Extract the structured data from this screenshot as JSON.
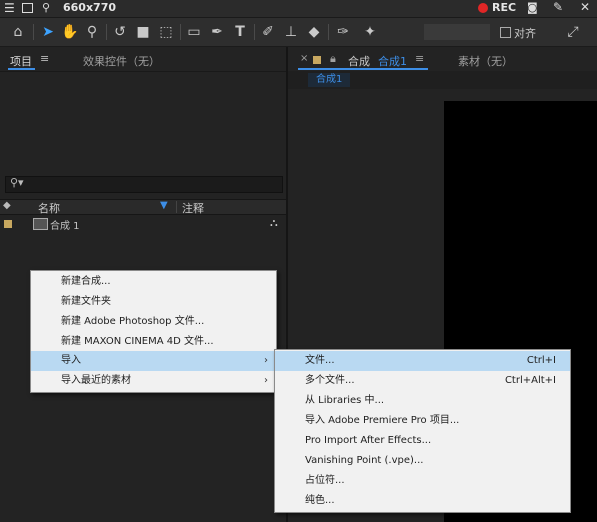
{
  "recorder": {
    "dimensions": "660x770",
    "rec_label": "REC"
  },
  "project_panel": {
    "tab_project": "项目",
    "tab_effects": "效果控件（无）",
    "columns": {
      "name": "名称",
      "comment": "注释"
    },
    "items": [
      {
        "name": "合成 1"
      }
    ]
  },
  "comp_panel": {
    "tab_comp_prefix": "合成",
    "tab_comp_name": "合成1",
    "tab_footage": "素材（无）",
    "breadcrumb": "合成1"
  },
  "toolbar": {
    "snap_label": "对齐"
  },
  "context_menu": {
    "items": [
      {
        "label": "新建合成..."
      },
      {
        "label": "新建文件夹"
      },
      {
        "label": "新建 Adobe Photoshop 文件..."
      },
      {
        "label": "新建 MAXON CINEMA 4D 文件..."
      },
      {
        "label": "导入",
        "has_submenu": true,
        "highlighted": true
      },
      {
        "label": "导入最近的素材",
        "has_submenu": true
      }
    ]
  },
  "import_submenu": {
    "items": [
      {
        "label": "文件...",
        "shortcut": "Ctrl+I",
        "highlighted": true
      },
      {
        "label": "多个文件...",
        "shortcut": "Ctrl+Alt+I"
      },
      {
        "label": "从 Libraries 中..."
      },
      {
        "label": "导入 Adobe Premiere Pro 项目..."
      },
      {
        "label": "Pro Import After Effects..."
      },
      {
        "label": "Vanishing Point (.vpe)..."
      },
      {
        "label": "占位符..."
      },
      {
        "label": "纯色..."
      }
    ]
  },
  "colors": {
    "accent": "#3d8ee6",
    "menu_highlight": "#b9d9f2",
    "rec_red": "#e02626",
    "item_label": "#c8a860"
  }
}
